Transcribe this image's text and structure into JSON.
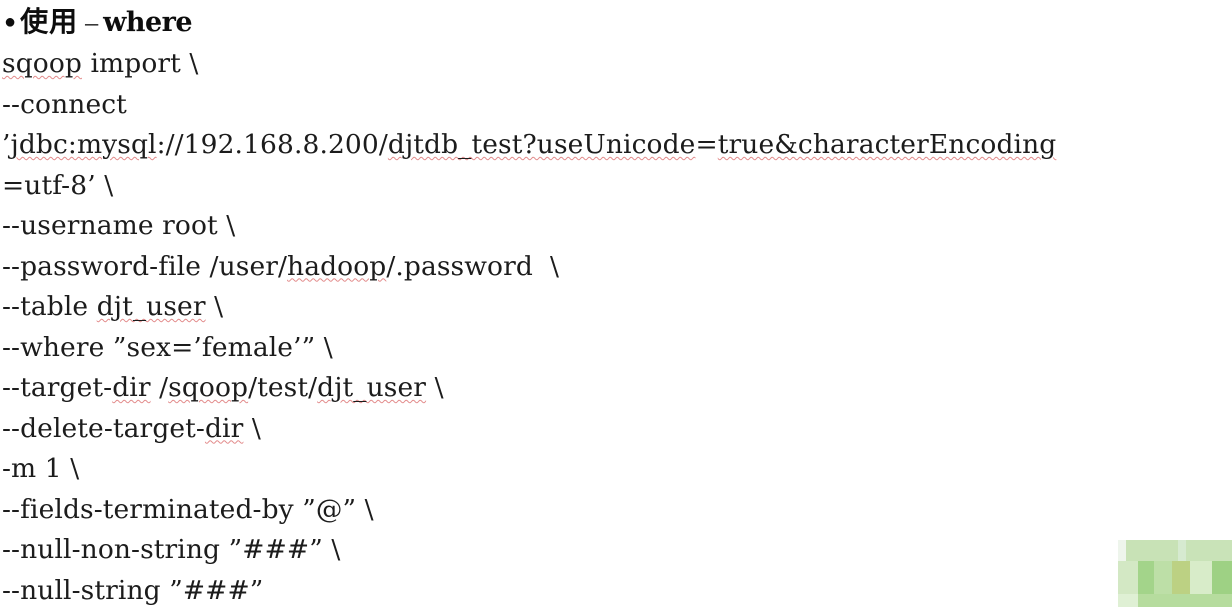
{
  "heading": {
    "bullet": "●",
    "topic": "使用",
    "dash": "–",
    "keyword": "where"
  },
  "code": {
    "language": "shell",
    "lines": [
      {
        "id": "line-1",
        "text": "sqoop import \\",
        "misspelled": [
          "sqoop"
        ]
      },
      {
        "id": "line-2",
        "text": "--connect",
        "misspelled": []
      },
      {
        "id": "line-3",
        "text": "’jdbc:mysql://192.168.8.200/djtdb_test?useUnicode=true&characterEncoding",
        "misspelled": [
          "jdbc:mysql",
          "djtdb_test?useUnicode",
          "true&characterEncoding"
        ]
      },
      {
        "id": "line-4",
        "text": "=utf-8’ \\",
        "misspelled": []
      },
      {
        "id": "line-5",
        "text": "--username root \\",
        "misspelled": []
      },
      {
        "id": "line-6",
        "text": "--password-file /user/hadoop/.password  \\",
        "misspelled": [
          "hadoop"
        ]
      },
      {
        "id": "line-7",
        "text": "--table djt_user \\",
        "misspelled": [
          "djt_user"
        ]
      },
      {
        "id": "line-8",
        "text": "--where ”sex=’female’” \\",
        "misspelled": []
      },
      {
        "id": "line-9",
        "text": "--target-dir /sqoop/test/djt_user \\",
        "misspelled": [
          "dir",
          "sqoop",
          "djt_user"
        ]
      },
      {
        "id": "line-10",
        "text": "--delete-target-dir \\",
        "misspelled": [
          "dir"
        ]
      },
      {
        "id": "line-11",
        "text": "-m 1 \\",
        "misspelled": []
      },
      {
        "id": "line-12",
        "text": "--fields-terminated-by ”@” \\",
        "misspelled": []
      },
      {
        "id": "line-13",
        "text": "--null-non-string ”###” \\",
        "misspelled": []
      },
      {
        "id": "line-14",
        "text": "--null-string ”###”",
        "misspelled": []
      }
    ]
  },
  "watermark": {
    "label": "green-watermark-block",
    "colors": {
      "page_background": "#ffffff",
      "text": "#1c1c1c",
      "spellcheck_underline": "#e28a8a",
      "wm_pale": "#eef5ec",
      "wm_light": "#d3e8c4",
      "wm_mid": "#c4e0b0",
      "wm_green": "#a3d48a",
      "wm_green2": "#9ed184",
      "wm_olive": "#bcd183",
      "wm_soft": "#d8ecc9",
      "wm_edge": "#cfe8bf"
    }
  }
}
